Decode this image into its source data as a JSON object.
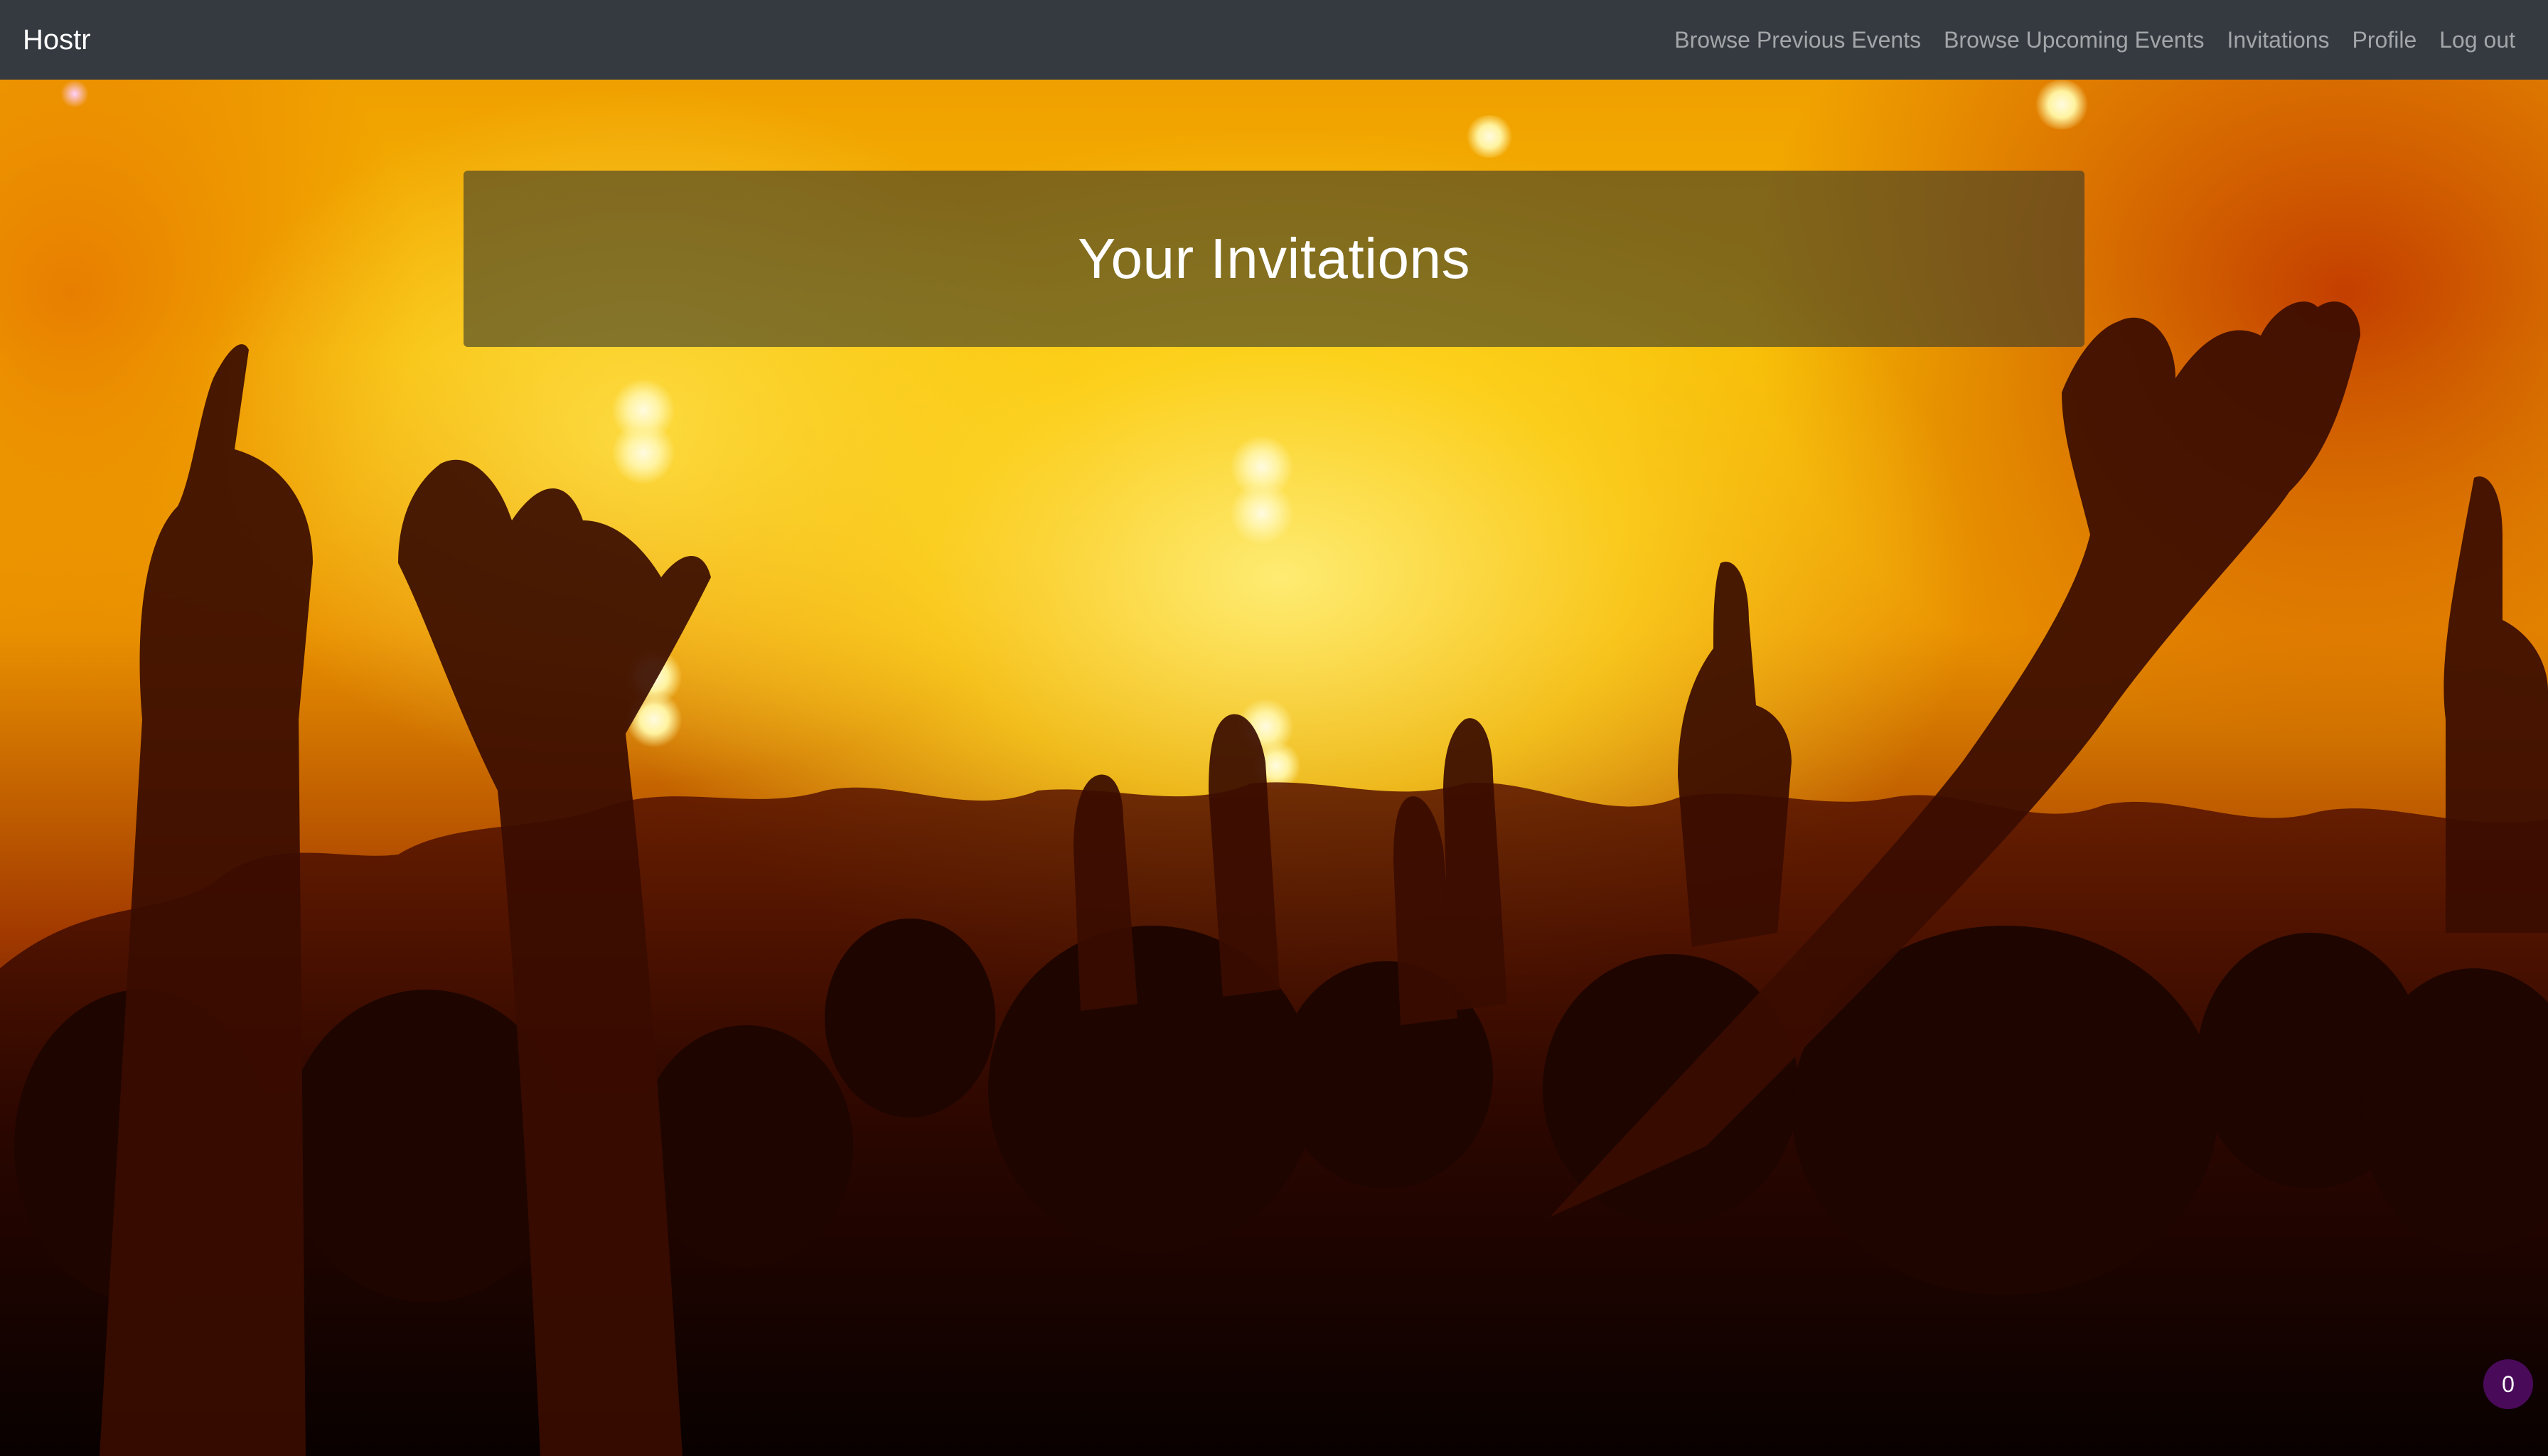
{
  "navbar": {
    "brand": "Hostr",
    "links": [
      "Browse Previous Events",
      "Browse Upcoming Events",
      "Invitations",
      "Profile",
      "Log out"
    ]
  },
  "hero": {
    "title": "Your Invitations"
  },
  "badge": {
    "count": "0"
  },
  "colors": {
    "navbar_bg": "#343a40",
    "badge_bg": "#4a0a5a"
  }
}
